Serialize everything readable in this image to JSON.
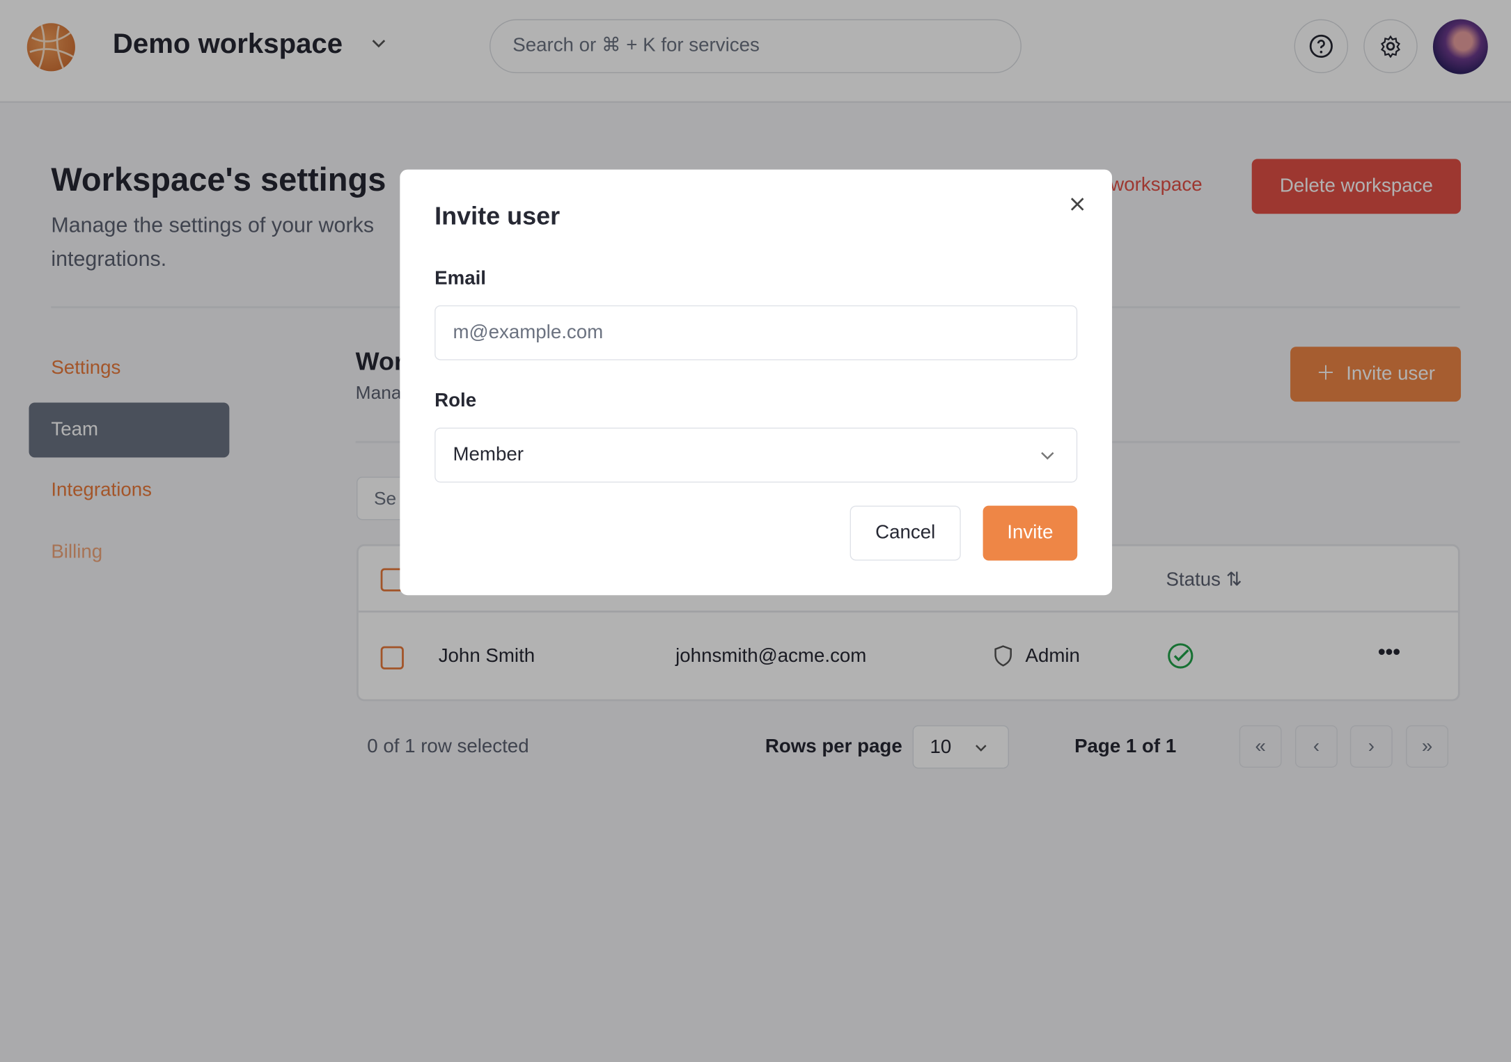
{
  "header": {
    "workspace_name": "Demo workspace",
    "search_placeholder": "Search or ⌘ + K for services",
    "icons": [
      "logo",
      "chevron-down-icon",
      "help-icon",
      "gear-icon",
      "avatar"
    ]
  },
  "page": {
    "title": "Workspace's settings",
    "subtitle_line1": "Manage the settings of your works",
    "subtitle_line2": "integrations.",
    "leave_link": "workspace",
    "delete_button": "Delete workspace"
  },
  "sidebar": {
    "items": [
      {
        "label": "Settings"
      },
      {
        "label": "Team",
        "active": true
      },
      {
        "label": "Integrations"
      },
      {
        "label": "Billing"
      }
    ]
  },
  "team": {
    "title_partial": "Wor",
    "desc_partial": "Mana",
    "search_partial": "Se",
    "invite_button": "Invite user",
    "columns": {
      "status": "Status"
    },
    "rows": [
      {
        "name": "John Smith",
        "email": "johnsmith@acme.com",
        "role": "Admin",
        "status": "active"
      }
    ],
    "selection": "0 of 1 row selected",
    "rows_per_page_label": "Rows per page",
    "rows_per_page": "10",
    "page_info": "Page 1 of 1"
  },
  "modal": {
    "title": "Invite user",
    "email_label": "Email",
    "email_placeholder": "m@example.com",
    "email_value": "",
    "role_label": "Role",
    "role_value": "Member",
    "cancel": "Cancel",
    "invite": "Invite"
  },
  "colors": {
    "accent": "#ee8646",
    "danger": "#e14f45",
    "success": "#22a34a",
    "sidebar_active": "#6b7383"
  }
}
